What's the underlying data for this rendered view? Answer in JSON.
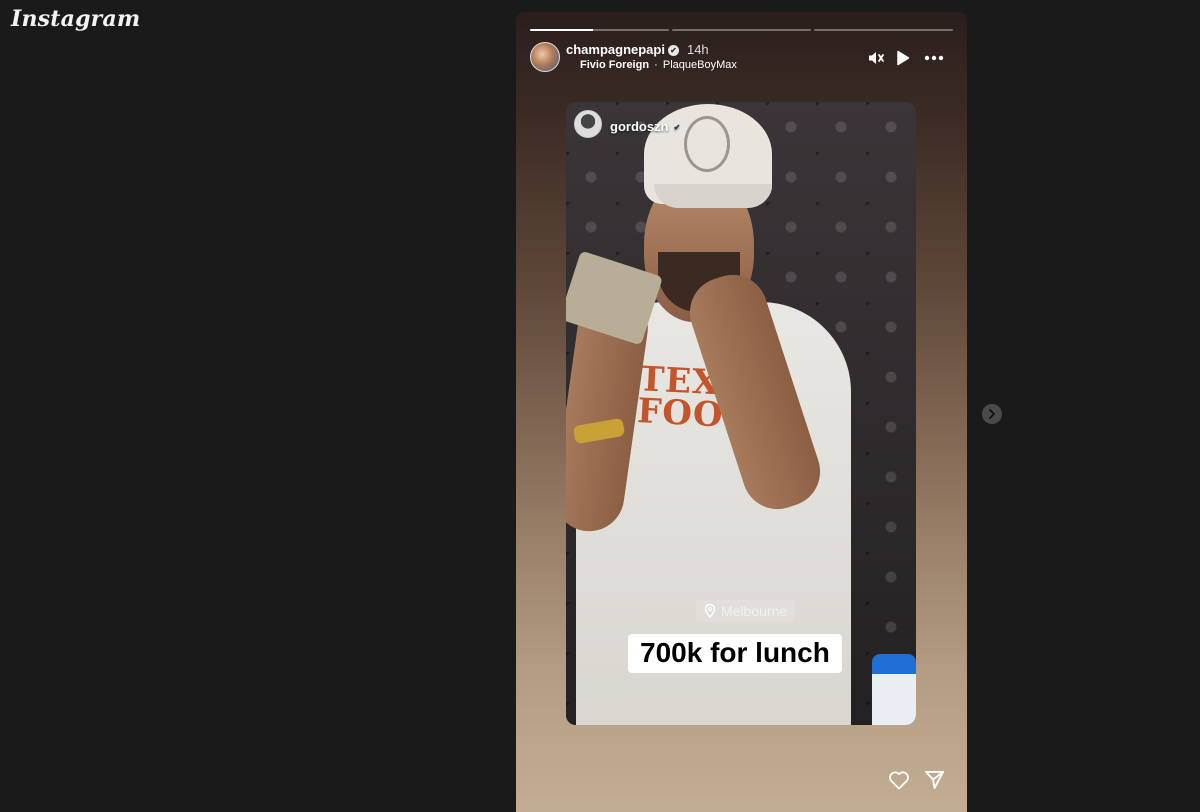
{
  "app": {
    "logo_text": "Instagram"
  },
  "story": {
    "progress": [
      {
        "fill": 0.45
      },
      {
        "fill": 0
      },
      {
        "fill": 0
      }
    ],
    "author": {
      "username": "champagnepapi",
      "verified_icon": "✔",
      "time": "14h"
    },
    "music": {
      "title": "Fivio Foreign",
      "separator": "·",
      "artist": "PlaqueBoyMax"
    },
    "controls": {
      "mute_icon": "speaker-muted-icon",
      "play_icon": "play-icon",
      "more_icon": "more-icon"
    },
    "reshared_post": {
      "username": "gordoszn",
      "verified_icon": "✔",
      "shirt_text_line1": "TEX",
      "shirt_text_line2": "FOOTB",
      "location": "Melbourne",
      "caption": "700k for lunch"
    },
    "actions": {
      "like_icon": "heart-icon",
      "share_icon": "send-icon"
    }
  },
  "navigation": {
    "next_icon": "chevron-right-icon"
  }
}
